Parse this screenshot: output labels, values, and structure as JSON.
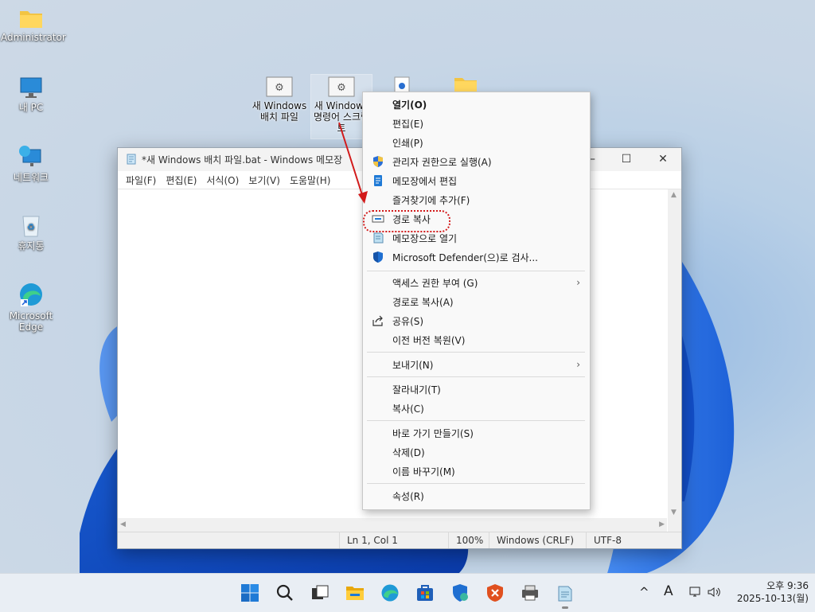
{
  "desktop": {
    "icons": [
      {
        "label": "Administrator",
        "icon": "folder-icon"
      },
      {
        "label": "내 PC",
        "icon": "monitor-icon"
      },
      {
        "label": "네트워크",
        "icon": "network-icon"
      },
      {
        "label": "휴지통",
        "icon": "recycle-bin-icon"
      },
      {
        "label": "Microsoft Edge",
        "icon": "edge-icon"
      }
    ],
    "file_icons": [
      {
        "label": "새 Windows 배치 파일",
        "icon": "batch-file-icon"
      },
      {
        "label": "새 Windows 명령어 스크립트",
        "icon": "cmd-script-icon"
      }
    ]
  },
  "notepad": {
    "title": "*새 Windows 배치 파일.bat - Windows 메모장",
    "menu": [
      "파일(F)",
      "편집(E)",
      "서식(O)",
      "보기(V)",
      "도움말(H)"
    ],
    "status": {
      "position": "Ln 1, Col 1",
      "zoom": "100%",
      "line_ending": "Windows (CRLF)",
      "encoding": "UTF-8"
    }
  },
  "context_menu": {
    "groups": [
      [
        {
          "label": "열기(O)",
          "bold": true
        },
        {
          "label": "편집(E)"
        },
        {
          "label": "인쇄(P)"
        },
        {
          "label": "관리자 권한으로 실행(A)",
          "icon": "shield-icon"
        },
        {
          "label": "메모장에서 편집",
          "icon": "notepad-icon"
        },
        {
          "label": "즐겨찾기에 추가(F)"
        },
        {
          "label": "경로 복사",
          "icon": "copy-path-icon"
        },
        {
          "label": "메모장으로 열기",
          "icon": "notepad-classic-icon"
        },
        {
          "label": "Microsoft Defender(으)로 검사...",
          "icon": "defender-icon"
        }
      ],
      [
        {
          "label": "액세스 권한 부여 (G)",
          "submenu": true
        },
        {
          "label": "경로로 복사(A)"
        },
        {
          "label": "공유(S)",
          "icon": "share-icon"
        },
        {
          "label": "이전 버전 복원(V)"
        }
      ],
      [
        {
          "label": "보내기(N)",
          "submenu": true
        }
      ],
      [
        {
          "label": "잘라내기(T)"
        },
        {
          "label": "복사(C)"
        }
      ],
      [
        {
          "label": "바로 가기 만들기(S)"
        },
        {
          "label": "삭제(D)"
        },
        {
          "label": "이름 바꾸기(M)"
        }
      ],
      [
        {
          "label": "속성(R)"
        }
      ]
    ],
    "submenu_glyph": "›"
  },
  "taskbar": {
    "apps": [
      "start-icon",
      "search-icon",
      "task-view-icon",
      "file-explorer-icon",
      "edge-icon",
      "store-icon",
      "security-icon",
      "app-x-icon",
      "printer-icon",
      "notepad-icon"
    ],
    "tray": {
      "chevron": "^",
      "ime": "A",
      "network": "network-icon",
      "volume": "volume-icon"
    },
    "clock": {
      "time": "오후 9:36",
      "date": "2025-10-13(월)"
    }
  },
  "colors": {
    "accent": "#0067c0",
    "annotation": "#d21a1a"
  }
}
